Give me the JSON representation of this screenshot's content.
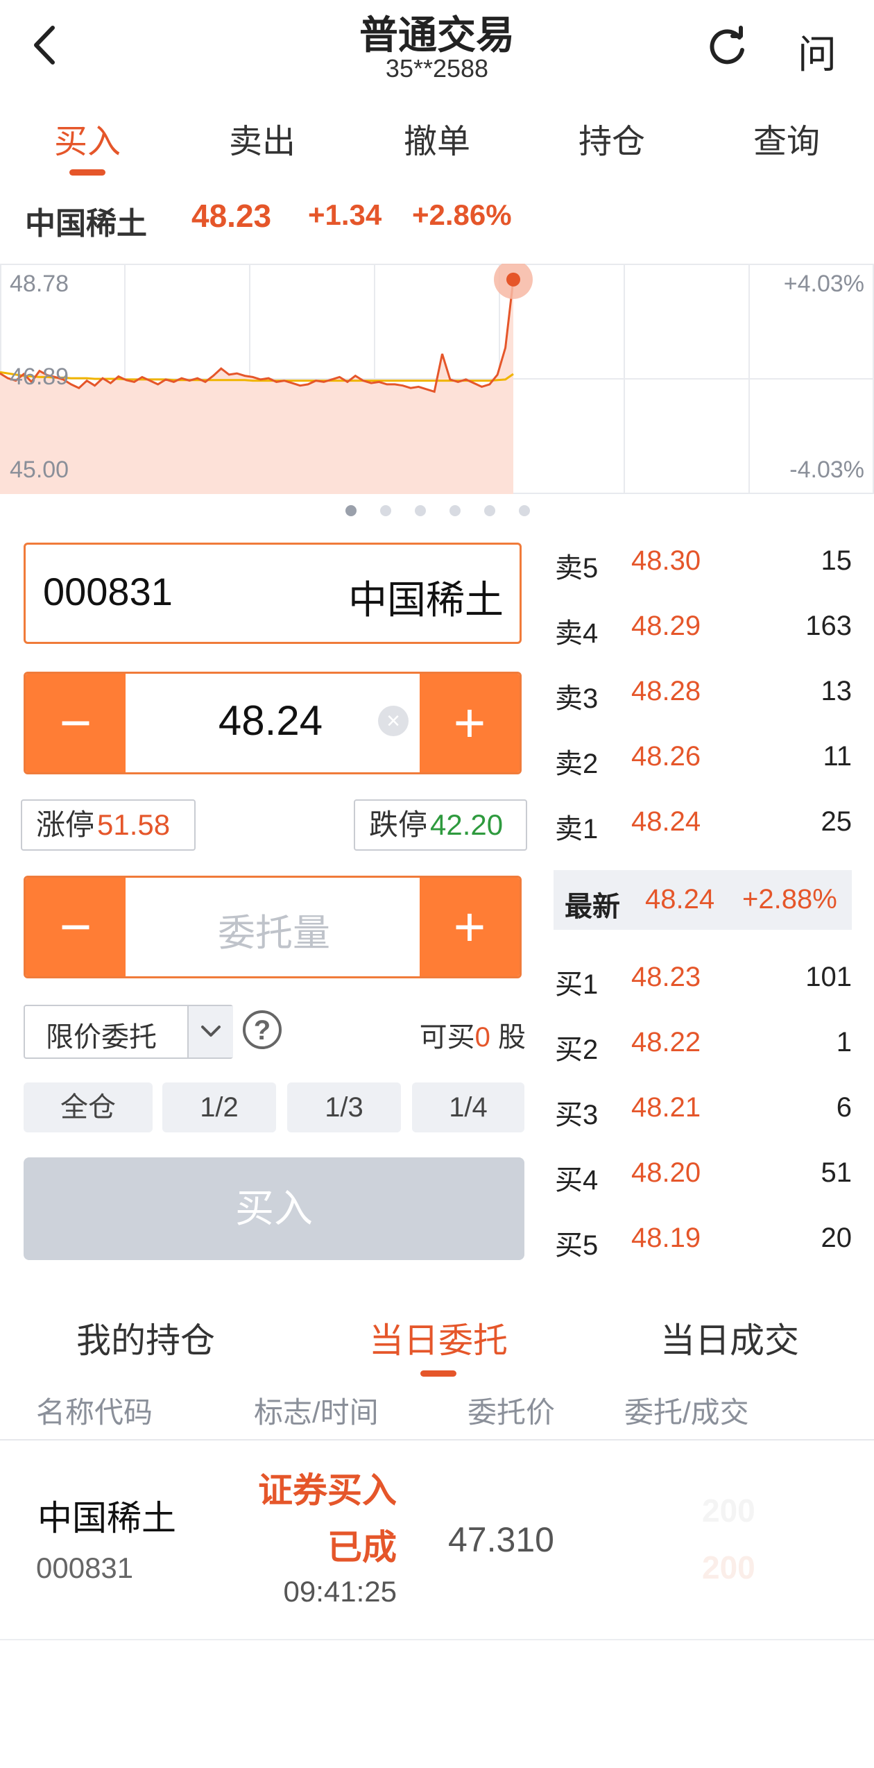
{
  "header": {
    "title": "普通交易",
    "account": "35**2588",
    "help_label": "问"
  },
  "tabs": [
    {
      "label": "买入",
      "active": true
    },
    {
      "label": "卖出"
    },
    {
      "label": "撤单"
    },
    {
      "label": "持仓"
    },
    {
      "label": "查询"
    }
  ],
  "quote": {
    "name": "中国稀土",
    "price": "48.23",
    "change": "+1.34",
    "change_pct": "+2.86%"
  },
  "chart_data": {
    "type": "line",
    "y_labels_left": [
      "48.78",
      "46.89",
      "45.00"
    ],
    "y_labels_right": [
      "+4.03%",
      "-4.03%"
    ],
    "ylim": [
      45.0,
      48.78
    ],
    "prev_close": 46.89,
    "series": [
      {
        "values": [
          46.98,
          46.9,
          46.86,
          46.97,
          46.84,
          47.02,
          46.95,
          46.92,
          46.88,
          46.8,
          46.74,
          46.86,
          46.78,
          46.9,
          46.82,
          46.93,
          46.87,
          46.84,
          46.92,
          46.86,
          46.8,
          46.88,
          46.84,
          46.9,
          46.86,
          46.9,
          46.84,
          46.94,
          47.06,
          46.96,
          46.98,
          46.94,
          46.92,
          46.88,
          46.9,
          46.84,
          46.86,
          46.82,
          46.78,
          46.8,
          46.86,
          46.84,
          46.88,
          46.92,
          46.84,
          46.94,
          46.86,
          46.82,
          46.84,
          46.8,
          46.8,
          46.78,
          46.74,
          46.76,
          46.72,
          46.68,
          47.3,
          46.88,
          46.84,
          46.88,
          46.82,
          46.76,
          46.8,
          46.96,
          47.4,
          48.52
        ]
      },
      {
        "values": [
          47.0,
          46.98,
          46.96,
          46.94,
          46.93,
          46.92,
          46.92,
          46.91,
          46.91,
          46.9,
          46.9,
          46.9,
          46.89,
          46.89,
          46.89,
          46.89,
          46.88,
          46.88,
          46.88,
          46.88,
          46.88,
          46.88,
          46.87,
          46.87,
          46.87,
          46.87,
          46.87,
          46.87,
          46.87,
          46.87,
          46.87,
          46.87,
          46.86,
          46.86,
          46.86,
          46.86,
          46.86,
          46.86,
          46.86,
          46.86,
          46.86,
          46.86,
          46.86,
          46.86,
          46.86,
          46.86,
          46.86,
          46.86,
          46.86,
          46.86,
          46.86,
          46.86,
          46.86,
          46.86,
          46.86,
          46.86,
          46.86,
          46.86,
          46.86,
          46.86,
          46.86,
          46.86,
          46.86,
          46.87,
          46.88,
          46.97
        ]
      }
    ],
    "colors": {
      "line": "#e5562a",
      "avg": "#f0b400",
      "fill": "#fde1d8"
    }
  },
  "pager": {
    "count": 6,
    "active": 0
  },
  "order": {
    "code": "000831",
    "name": "中国稀土",
    "price": "48.24",
    "qty_placeholder": "委托量",
    "limit_up_label": "涨停",
    "limit_up": "51.58",
    "limit_down_label": "跌停",
    "limit_down": "42.20",
    "order_type": "限价委托",
    "can_buy_prefix": "可买",
    "can_buy": "0",
    "can_buy_unit": "股",
    "ratios": [
      "全仓",
      "1/2",
      "1/3",
      "1/4"
    ],
    "buy_label": "买入"
  },
  "orderbook": {
    "asks": [
      {
        "label": "卖5",
        "price": "48.30",
        "vol": "15"
      },
      {
        "label": "卖4",
        "price": "48.29",
        "vol": "163"
      },
      {
        "label": "卖3",
        "price": "48.28",
        "vol": "13"
      },
      {
        "label": "卖2",
        "price": "48.26",
        "vol": "11"
      },
      {
        "label": "卖1",
        "price": "48.24",
        "vol": "25"
      }
    ],
    "latest": {
      "label": "最新",
      "price": "48.24",
      "pct": "+2.88%"
    },
    "bids": [
      {
        "label": "买1",
        "price": "48.23",
        "vol": "101"
      },
      {
        "label": "买2",
        "price": "48.22",
        "vol": "1"
      },
      {
        "label": "买3",
        "price": "48.21",
        "vol": "6"
      },
      {
        "label": "买4",
        "price": "48.20",
        "vol": "51"
      },
      {
        "label": "买5",
        "price": "48.19",
        "vol": "20"
      }
    ]
  },
  "bottom_tabs": [
    {
      "label": "我的持仓"
    },
    {
      "label": "当日委托",
      "active": true
    },
    {
      "label": "当日成交"
    }
  ],
  "table": {
    "headers": [
      "名称代码",
      "标志/时间",
      "委托价",
      "委托/成交"
    ],
    "rows": [
      {
        "name": "中国稀土",
        "code": "000831",
        "op": "证券买入",
        "status": "已成",
        "time": "09:41:25",
        "price": "47.310",
        "qty": "200",
        "filled": "200"
      }
    ]
  },
  "accent": "#e5562a",
  "stepper_color": "#ff7d35"
}
